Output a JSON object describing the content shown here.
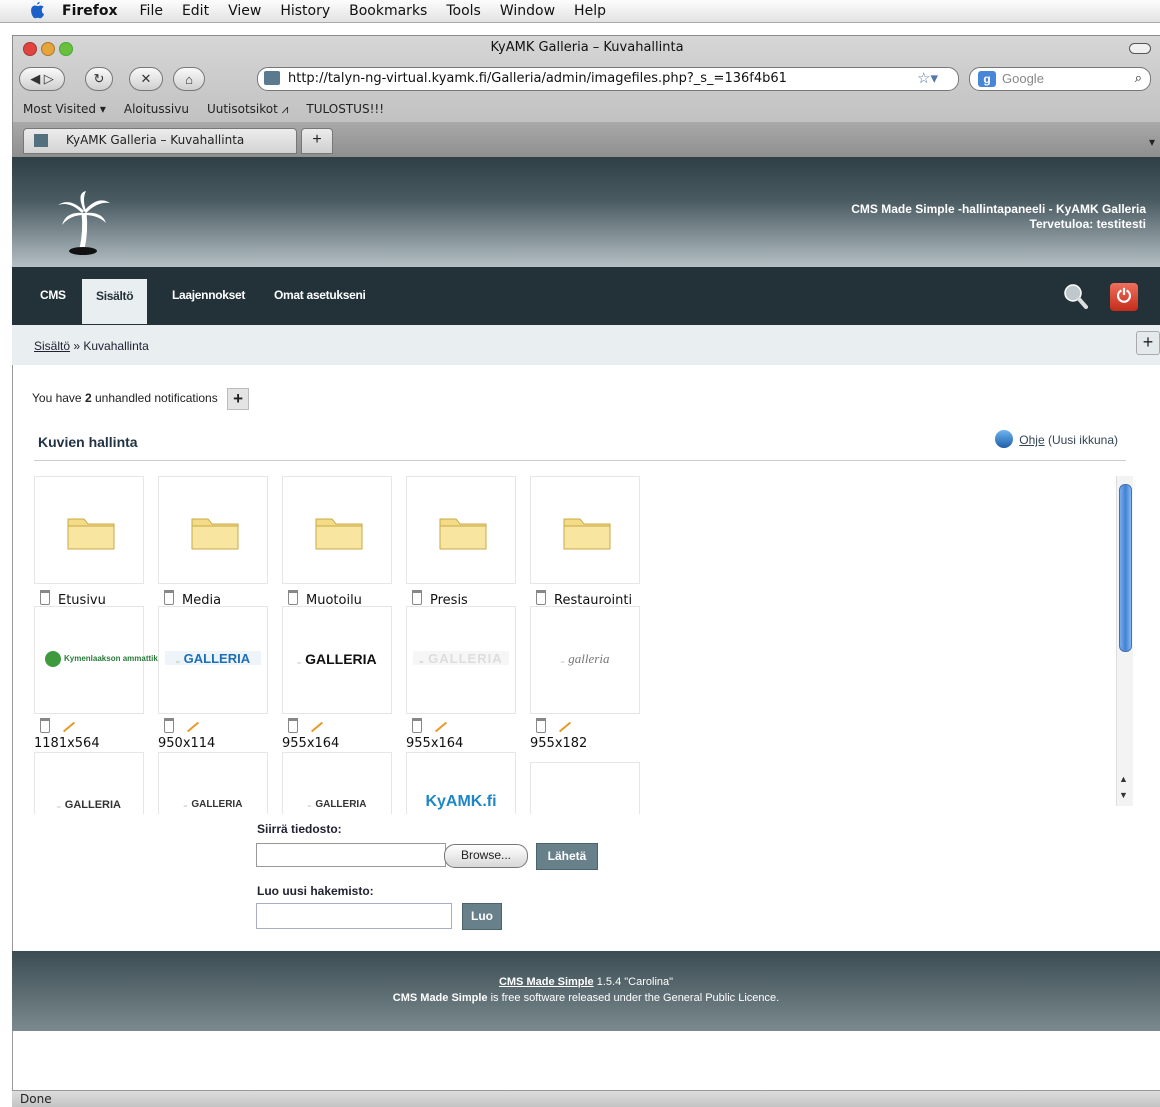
{
  "mac_menu": {
    "app": "Firefox",
    "items": [
      "File",
      "Edit",
      "View",
      "History",
      "Bookmarks",
      "Tools",
      "Window",
      "Help"
    ]
  },
  "window": {
    "title": "KyAMK Galleria – Kuvahallinta"
  },
  "toolbar": {
    "url": "http://talyn-ng-virtual.kyamk.fi/Galleria/admin/imagefiles.php?_s_=136f4b61",
    "search_placeholder": "Google"
  },
  "bookmarks": [
    "Most Visited ▾",
    "Aloitussivu",
    "Uutisotsikot ⩘",
    "TULOSTUS!!!"
  ],
  "tab": {
    "title": "KyAMK Galleria – Kuvahallinta"
  },
  "cms_header": {
    "line1": "CMS Made Simple -hallintapaneeli - KyAMK Galleria",
    "line2": "Tervetuloa: testitesti"
  },
  "nav": {
    "items": [
      "CMS",
      "Sisältö",
      "Laajennokset",
      "Omat asetukseni"
    ],
    "active": "Sisältö"
  },
  "breadcrumb": {
    "link": "Sisältö",
    "sep": " » ",
    "current": "Kuvahallinta"
  },
  "notifications": {
    "prefix": "You have ",
    "count": "2",
    "suffix": " unhandled notifications"
  },
  "page": {
    "title": "Kuvien hallinta",
    "help_link": "Ohje",
    "help_suffix": " (Uusi ikkuna)"
  },
  "folders": [
    "Etusivu",
    "Media",
    "Muotoilu",
    "Presis",
    "Restaurointi"
  ],
  "images": [
    {
      "logo": "Kymenlaakson ammattikorkeakoulu",
      "dims": "1181x564"
    },
    {
      "logo": "GALLERIA",
      "dims": "950x114"
    },
    {
      "logo": "GALLERIA",
      "dims": "955x164"
    },
    {
      "logo": "GALLERIA",
      "dims": "955x164"
    },
    {
      "logo": "galleria",
      "dims": "955x182"
    }
  ],
  "row3": [
    "GALLERIA",
    "GALLERIA",
    "GALLERIA",
    "KyAMK.fi",
    ""
  ],
  "upload": {
    "label": "Siirrä tiedosto:",
    "browse": "Browse...",
    "submit": "Lähetä"
  },
  "newdir": {
    "label": "Luo uusi hakemisto:",
    "submit": "Luo"
  },
  "footer": {
    "link": "CMS Made Simple",
    "version": " 1.5.4 \"Carolina\"",
    "bold": "CMS Made Simple",
    "rest": " is free software released under the General Public Licence."
  },
  "status": "Done"
}
